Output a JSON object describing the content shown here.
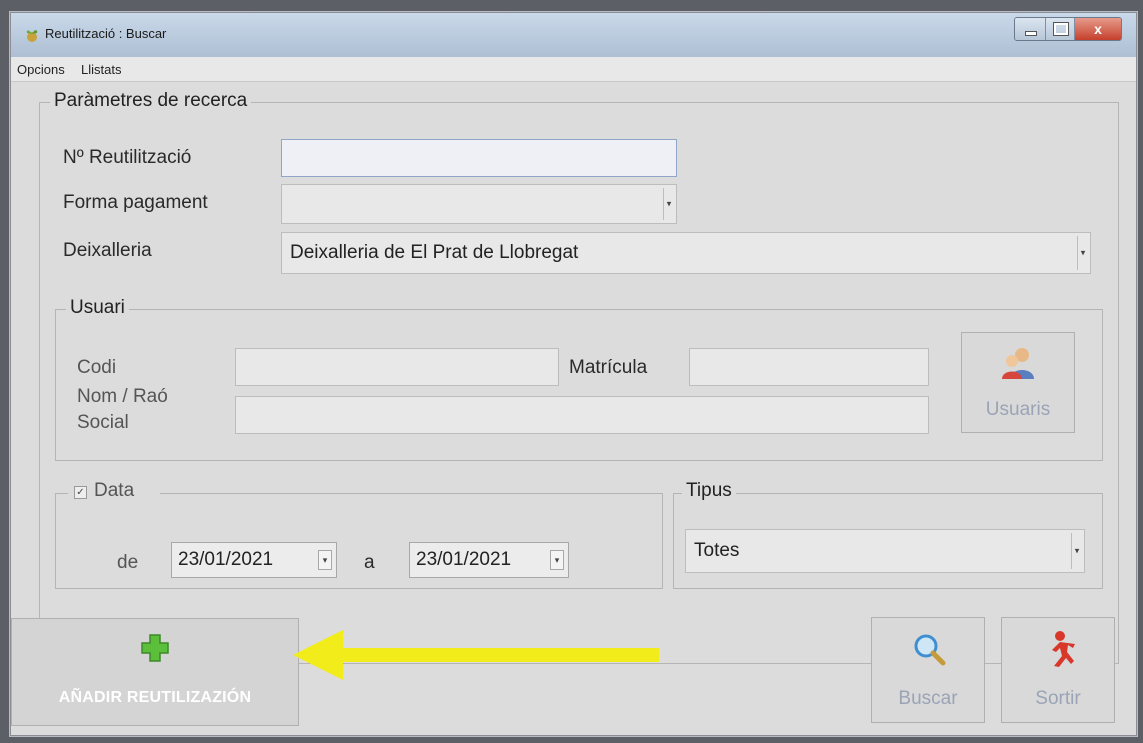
{
  "window": {
    "title": "Reutilització : Buscar",
    "close_glyph": "x"
  },
  "menubar": {
    "items": [
      "Opcions",
      "Llistats"
    ]
  },
  "search_params": {
    "legend": "Paràmetres de recerca",
    "num_reutilitzacio_label": "Nº Reutilització",
    "num_reutilitzacio_value": "",
    "forma_pagament_label": "Forma pagament",
    "forma_pagament_value": "",
    "deixalleria_label": "Deixalleria",
    "deixalleria_value": "Deixalleria de El Prat de Llobregat"
  },
  "usuari": {
    "legend": "Usuari",
    "codi_label": "Codi",
    "codi_value": "",
    "matricula_label": "Matrícula",
    "matricula_value": "",
    "nom_label_line1": "Nom / Raó",
    "nom_label_line2": "Social",
    "nom_value": "",
    "usuaris_button": "Usuaris"
  },
  "data_group": {
    "legend": "Data",
    "checked": true,
    "de_label": "de",
    "de_value": "23/01/2021",
    "a_label": "a",
    "a_value": "23/01/2021"
  },
  "tipus_group": {
    "legend": "Tipus",
    "value": "Totes"
  },
  "actions": {
    "add_label": "AÑADIR REUTILIZAZIÓN",
    "buscar_label": "Buscar",
    "sortir_label": "Sortir"
  },
  "icons": [
    "plant-icon",
    "add-plus-icon",
    "users-icon",
    "magnifier-icon",
    "exit-person-icon",
    "yellow-arrow-annotation"
  ],
  "colors": {
    "add_icon": "#5cbf3c",
    "annotation_arrow": "#f2ec1a",
    "disabled_text": "#9aa4b6",
    "title_bar": "#c3d4e8",
    "close_button": "#d0503a"
  }
}
